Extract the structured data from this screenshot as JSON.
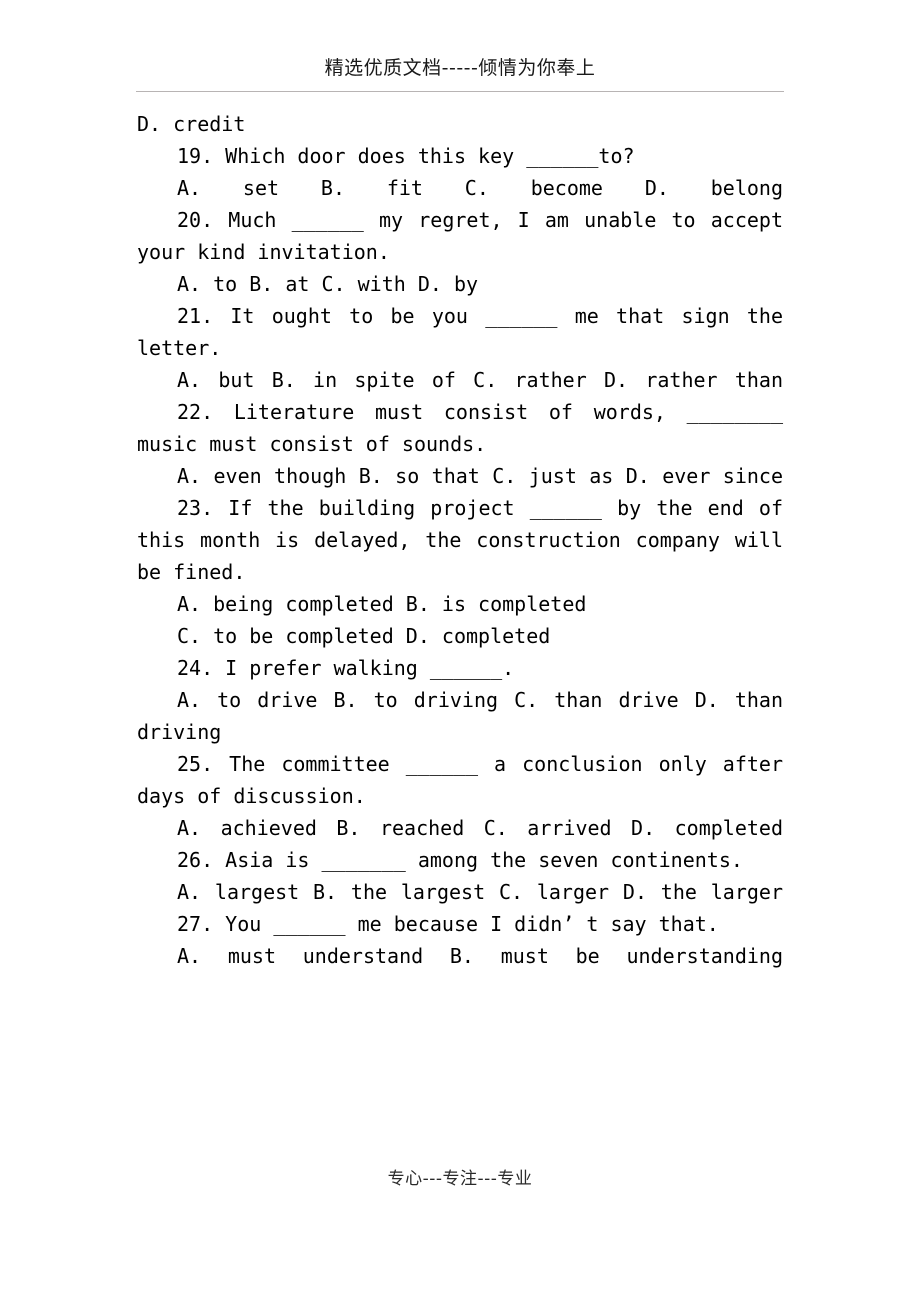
{
  "header": {
    "text": "精选优质文档-----倾情为你奉上"
  },
  "footer": {
    "text": "专心---专注---专业"
  },
  "document": {
    "blocks": [
      {
        "id": "q18-option-d",
        "kind": "option-line",
        "indent": false,
        "spread": false,
        "text": "D. credit"
      },
      {
        "id": "q19-stem",
        "kind": "question-stem",
        "indent": true,
        "spread": false,
        "number": "19.",
        "text": "19. Which door does this key ______to?"
      },
      {
        "id": "q19-options",
        "kind": "option-line",
        "indent": true,
        "spread": true,
        "text": "A. set        B. fit        C. become        D. belong"
      },
      {
        "id": "q20-stem",
        "kind": "question-stem",
        "indent": true,
        "spread": false,
        "number": "20.",
        "text": "20. Much ______ my regret, I am unable to accept your kind invitation."
      },
      {
        "id": "q20-options",
        "kind": "option-line",
        "indent": true,
        "spread": false,
        "text": "A. to        B. at        C. with        D. by"
      },
      {
        "id": "q21-stem",
        "kind": "question-stem",
        "indent": true,
        "spread": false,
        "number": "21.",
        "text": "21. It ought to be you ______ me that sign the letter."
      },
      {
        "id": "q21-options",
        "kind": "option-line",
        "indent": true,
        "spread": true,
        "text": "A. but        B. in spite of        C. rather D. rather than"
      },
      {
        "id": "q22-stem",
        "kind": "question-stem",
        "indent": true,
        "spread": false,
        "number": "22.",
        "text": "22. Literature must consist of words, ________ music must consist of sounds."
      },
      {
        "id": "q22-options",
        "kind": "option-line",
        "indent": true,
        "spread": true,
        "text": "A. even though        B. so that        C. just as        D. ever since"
      },
      {
        "id": "q23-stem",
        "kind": "question-stem",
        "indent": true,
        "spread": false,
        "number": "23.",
        "text": "23. If the building project ______ by the end of this month is delayed, the construction company will be fined."
      },
      {
        "id": "q23-options-ab",
        "kind": "option-line",
        "indent": true,
        "spread": false,
        "text": "A. being completed      B. is completed"
      },
      {
        "id": "q23-options-cd",
        "kind": "option-line",
        "indent": true,
        "spread": false,
        "text": "C. to be completed      D. completed"
      },
      {
        "id": "q24-stem",
        "kind": "question-stem",
        "indent": true,
        "spread": false,
        "number": "24.",
        "text": "24. I prefer walking ______."
      },
      {
        "id": "q24-options",
        "kind": "option-line",
        "indent": true,
        "spread": true,
        "text": "A. to drive        B. to driving        C. than drive        D. than driving"
      },
      {
        "id": "q25-stem",
        "kind": "question-stem",
        "indent": true,
        "spread": false,
        "number": "25.",
        "text": "25. The committee ______ a conclusion only after days of discussion."
      },
      {
        "id": "q25-options",
        "kind": "option-line",
        "indent": true,
        "spread": true,
        "text": "A. achieved        B. reached        C. arrived D. completed"
      },
      {
        "id": "q26-stem",
        "kind": "question-stem",
        "indent": true,
        "spread": false,
        "number": "26.",
        "text": "26. Asia is _______ among the seven continents."
      },
      {
        "id": "q26-options",
        "kind": "option-line",
        "indent": true,
        "spread": true,
        "text": "A. largest        B. the largest        C. larger D. the larger"
      },
      {
        "id": "q27-stem",
        "kind": "question-stem",
        "indent": true,
        "spread": false,
        "number": "27.",
        "text": "27. You ______ me because I didn’ t say that."
      },
      {
        "id": "q27-options",
        "kind": "option-line",
        "indent": true,
        "spread": false,
        "text": "A. must understand            B. must be understanding"
      }
    ]
  }
}
